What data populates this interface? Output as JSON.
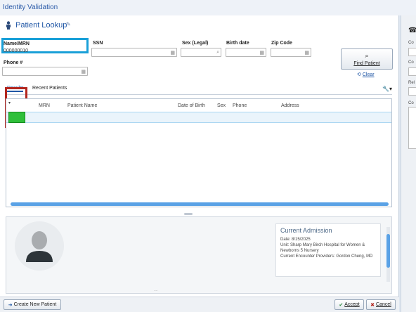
{
  "window": {
    "title": "Identity Validation"
  },
  "header": {
    "title": "Patient Lookup",
    "edit_icon": "pencil-icon",
    "person_icon": "person-icon"
  },
  "fields": {
    "name_mrn": {
      "label": "Name/MRN",
      "value": "000000010"
    },
    "ssn": {
      "label": "SSN"
    },
    "sex": {
      "label": "Sex (Legal)"
    },
    "birth_date": {
      "label": "Birth date"
    },
    "zip": {
      "label": "Zip Code"
    },
    "phone": {
      "label": "Phone #"
    }
  },
  "actions": {
    "find_patient": "Find Patient",
    "clear": "Clear"
  },
  "tabs": [
    {
      "label": "Results"
    },
    {
      "label": "Recent Patients"
    }
  ],
  "table": {
    "columns": [
      "MRN",
      "Patient Name",
      "Date of Birth",
      "Sex",
      "Phone",
      "Address"
    ]
  },
  "admission": {
    "title": "Current Admission",
    "date": "Date: 8/15/2025",
    "unit": "Unit: Sharp Mary Birch Hospital for Women & Newborns 5 Nursery",
    "providers": "Current Encounter Providers: Gordon Cheng, MD"
  },
  "footer": {
    "create": "Create New Patient",
    "accept": "Accept",
    "cancel": "Cancel"
  },
  "right_panel": {
    "labels": [
      "Co",
      "Co",
      "Rel",
      "Co"
    ]
  },
  "colors": {
    "accent": "#1f56a5",
    "highlight_blue": "#1aa0d8",
    "highlight_red": "#b3261e",
    "status_green": "#2fbf3a"
  }
}
